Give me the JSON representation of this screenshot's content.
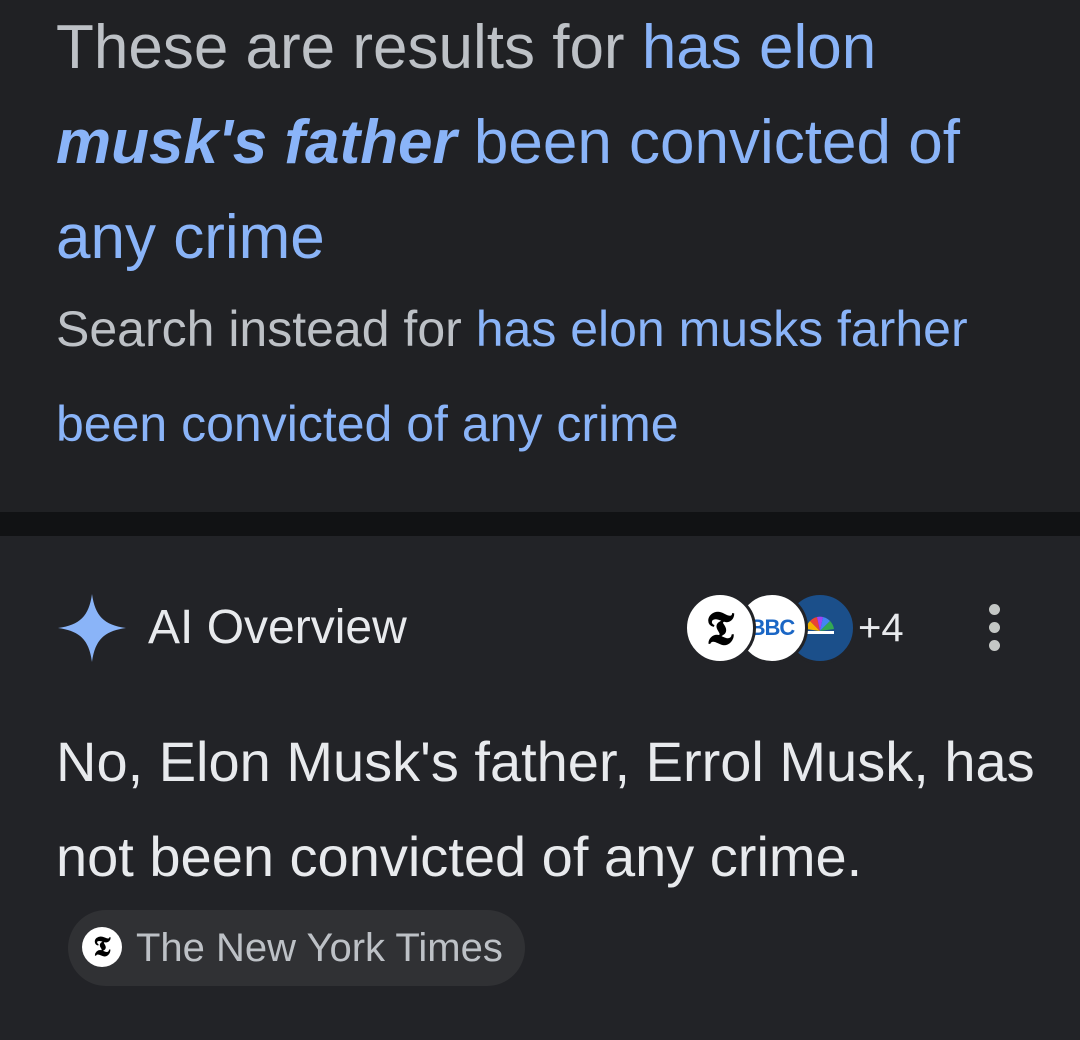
{
  "spelling": {
    "prefix": "These are results for",
    "query_part1": "has elon",
    "query_emphasis": "musk's father",
    "query_part2": "been convicted of any crime",
    "instead_prefix": "Search instead for",
    "instead_query": "has elon musks farher been convicted of any crime"
  },
  "ai_overview": {
    "title": "AI Overview",
    "icon": "sparkle-icon",
    "accent_color": "#8ab4f8",
    "sources": [
      {
        "name": "nyt-logo",
        "glyph": "𝕿"
      },
      {
        "name": "bbc-logo",
        "glyph": "BBC"
      },
      {
        "name": "nbc-logo",
        "glyph": ""
      }
    ],
    "sources_more": "+4",
    "menu_icon": "more-vert-icon",
    "answer": "No, Elon Musk's father, Errol Musk, has not been convicted of any crime.",
    "citation": {
      "source": "The New York Times",
      "glyph": "𝕿"
    }
  }
}
